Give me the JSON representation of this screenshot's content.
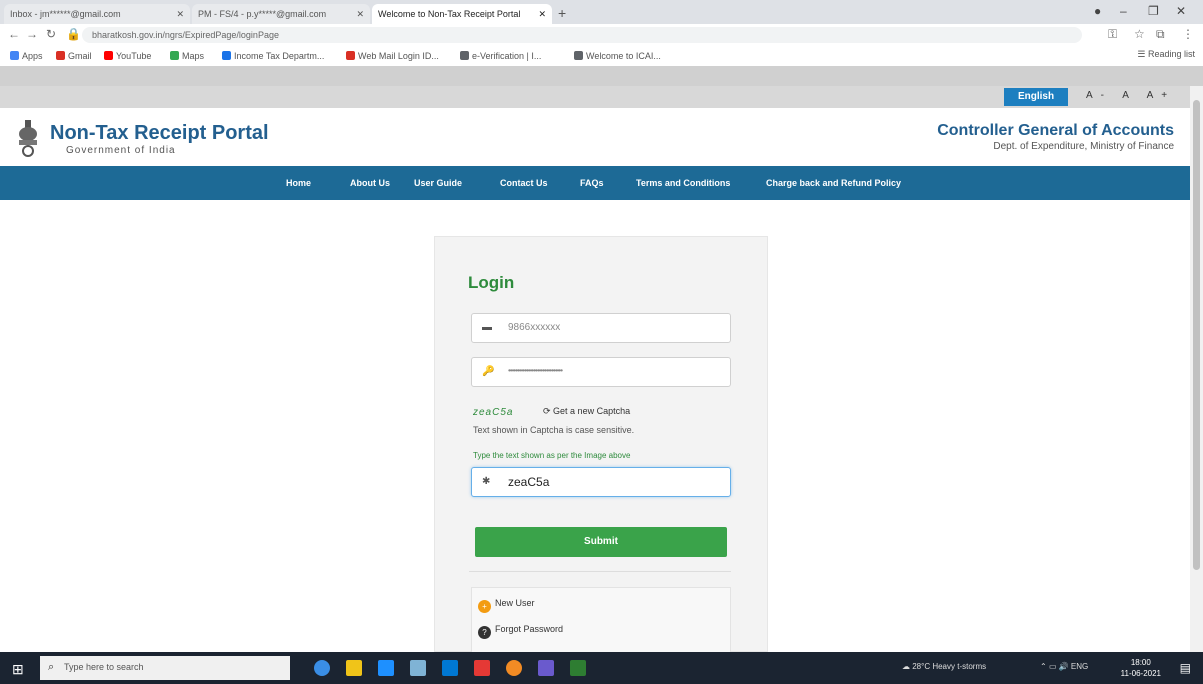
{
  "browser": {
    "tabs": [
      {
        "label": "Inbox - jm******@gmail.com"
      },
      {
        "label": "PM - FS/4 - p.y*****@gmail.com"
      },
      {
        "label": "Welcome to Non-Tax Receipt Portal"
      }
    ],
    "new_tab_label": "+",
    "url": "bharatkosh.gov.in/ngrs/ExpiredPage/loginPage",
    "bookmarks": [
      {
        "label": "Apps",
        "color": "#4285f4"
      },
      {
        "label": "Gmail",
        "color": "#d93025"
      },
      {
        "label": "YouTube",
        "color": "#ff0000"
      },
      {
        "label": "Maps",
        "color": "#34a853"
      },
      {
        "label": "Income Tax Departm...",
        "color": "#1a73e8"
      },
      {
        "label": "Web Mail Login ID...",
        "color": "#d93025"
      },
      {
        "label": "e-Verification | I...",
        "color": "#5f6368"
      },
      {
        "label": "Welcome to ICAI...",
        "color": "#5f6368"
      }
    ],
    "reading_list_label": "Reading list"
  },
  "topstrip": {
    "language_button": "English",
    "font_size_controls": "A- A A+"
  },
  "header": {
    "portal_title": "Non-Tax Receipt Portal",
    "portal_subtitle": "Government of India",
    "org_title": "Controller General of Accounts",
    "org_subtitle": "Dept. of Expenditure, Ministry of Finance"
  },
  "nav": {
    "items": [
      {
        "label": "Home"
      },
      {
        "label": "About Us"
      },
      {
        "label": "User Guide"
      },
      {
        "label": "Contact Us"
      },
      {
        "label": "FAQs"
      },
      {
        "label": "Terms and Conditions"
      },
      {
        "label": "Charge back and Refund Policy"
      }
    ]
  },
  "login": {
    "title": "Login",
    "username_value": "9866xxxxxx",
    "password_value": "••••••••••••••••••••••••••••••",
    "captcha_image_text": "zeaC5a",
    "refresh_captcha_label": "Get a new Captcha",
    "captcha_case_note": "Text shown in Captcha is case sensitive.",
    "captcha_hint": "Type the text shown as per the Image above",
    "captcha_value": "zeaC5a",
    "submit_label": "Submit",
    "new_user_label": "New User",
    "forgot_password_label": "Forgot Password"
  },
  "taskbar": {
    "search_placeholder": "Type here to search",
    "weather": "28°C Heavy t-storms",
    "tray_text": "ENG",
    "time": "18:00",
    "date": "11-06-2021",
    "app_icon_colors": [
      "#3a8ee6",
      "#f0c419",
      "#1e90ff",
      "#7fb3d5",
      "#0078d4",
      "#e53935",
      "#f28b24",
      "#6a5acd",
      "#2e7d32"
    ]
  }
}
